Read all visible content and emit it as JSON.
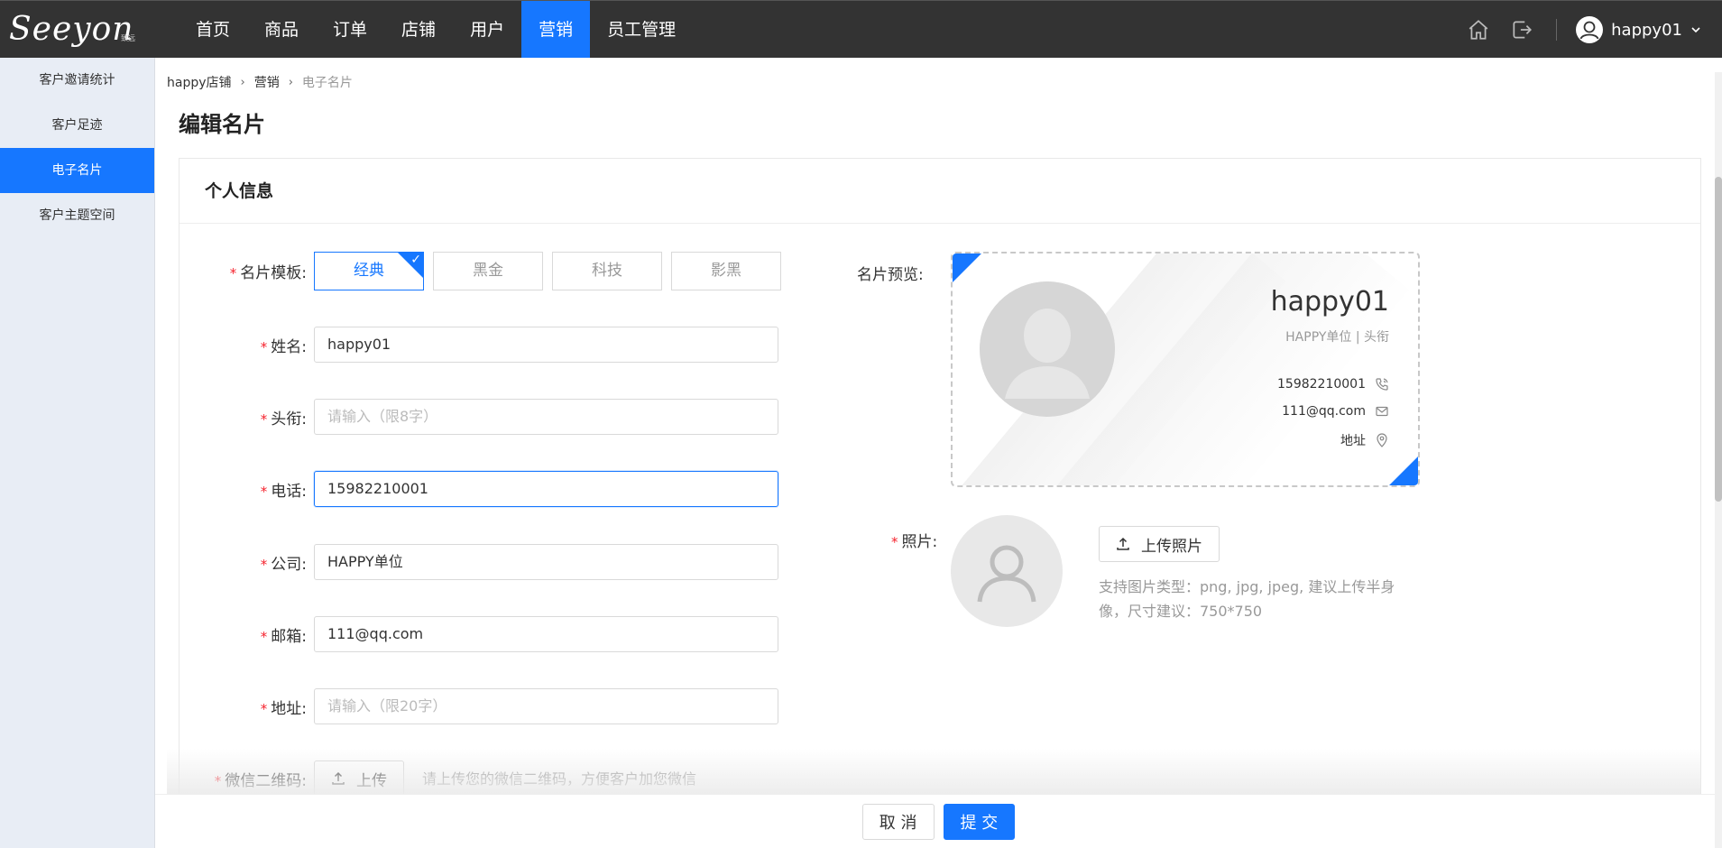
{
  "app": {
    "logo_text": "Seeyon",
    "logo_sub": "致远"
  },
  "nav": {
    "items": [
      {
        "label": "首页"
      },
      {
        "label": "商品"
      },
      {
        "label": "订单"
      },
      {
        "label": "店铺"
      },
      {
        "label": "用户"
      },
      {
        "label": "营销",
        "active": true
      },
      {
        "label": "员工管理"
      }
    ]
  },
  "user": {
    "name": "happy01"
  },
  "sidebar": {
    "items": [
      {
        "label": "客户邀请统计"
      },
      {
        "label": "客户足迹"
      },
      {
        "label": "电子名片",
        "active": true
      },
      {
        "label": "客户主题空间"
      }
    ]
  },
  "breadcrumb": {
    "items": [
      "happy店铺",
      "营销",
      "电子名片"
    ]
  },
  "page": {
    "title": "编辑名片"
  },
  "panel": {
    "title": "个人信息"
  },
  "form": {
    "template": {
      "label": "名片模板:",
      "options": [
        "经典",
        "黑金",
        "科技",
        "影黑"
      ],
      "selected": "经典"
    },
    "name": {
      "label": "姓名:",
      "value": "happy01",
      "placeholder": ""
    },
    "title": {
      "label": "头衔:",
      "value": "",
      "placeholder": "请输入（限8字）"
    },
    "phone": {
      "label": "电话:",
      "value": "15982210001",
      "placeholder": ""
    },
    "company": {
      "label": "公司:",
      "value": "HAPPY单位",
      "placeholder": ""
    },
    "email": {
      "label": "邮箱:",
      "value": "111@qq.com",
      "placeholder": ""
    },
    "address": {
      "label": "地址:",
      "value": "",
      "placeholder": "请输入（限20字）"
    },
    "wechat": {
      "label": "微信二维码:",
      "upload_label": "上传",
      "hint": "请上传您的微信二维码，方便客户加您微信"
    },
    "required_mark": "*"
  },
  "preview": {
    "label": "名片预览:",
    "name": "happy01",
    "sub": "HAPPY单位 | 头衔",
    "phone": "15982210001",
    "email": "111@qq.com",
    "address": "地址"
  },
  "photo": {
    "label": "照片:",
    "upload_label": "上传照片",
    "hint_line1": "支持图片类型：png, jpg, jpeg, 建议上传半身",
    "hint_line2": "像，尺寸建议：750*750"
  },
  "footer": {
    "cancel_label": "取 消",
    "submit_label": "提 交"
  },
  "colors": {
    "primary": "#1677ff",
    "topbar": "#333333",
    "sidebar": "#e8edf5",
    "required": "#f5222d"
  }
}
